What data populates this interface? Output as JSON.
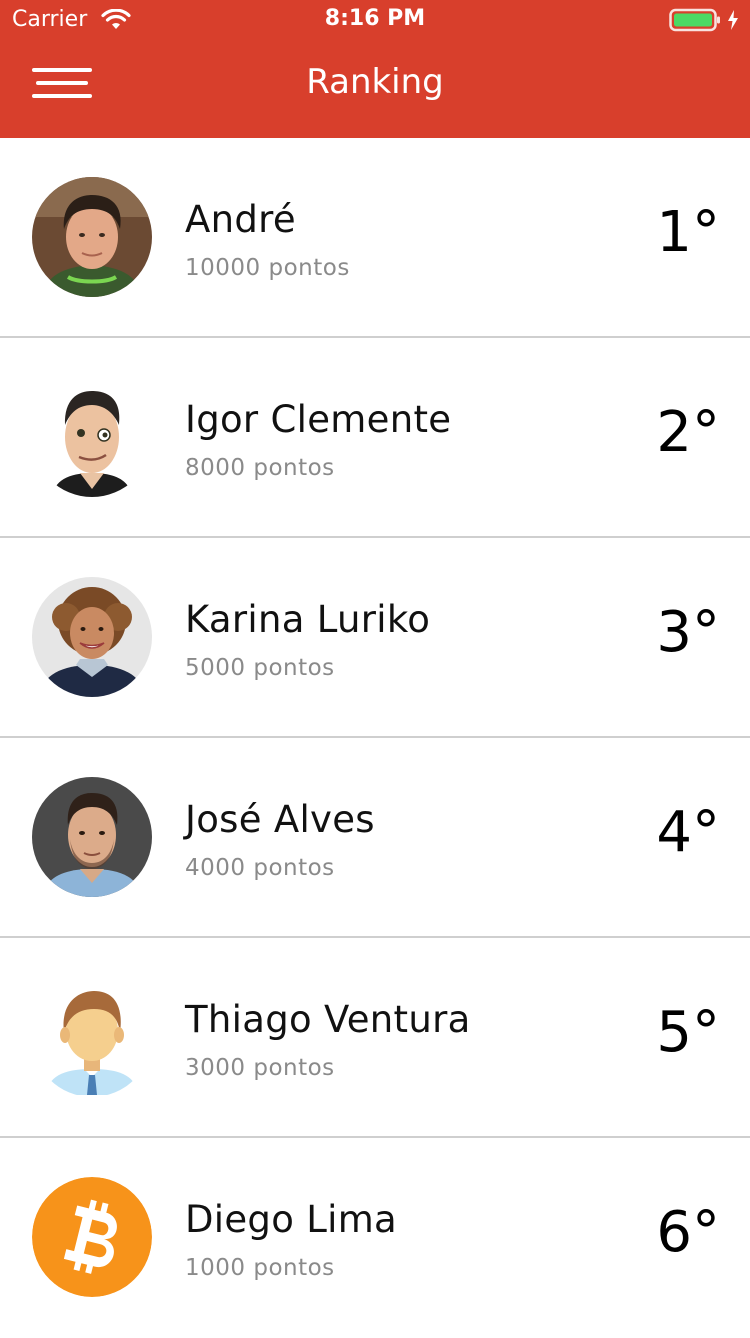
{
  "status_bar": {
    "carrier": "Carrier",
    "time": "8:16 PM",
    "battery_color": "#4cd964"
  },
  "nav": {
    "title": "Ranking",
    "background": "#d83f2c",
    "menu_icon": "hamburger-menu-icon"
  },
  "ranking": [
    {
      "name": "André",
      "points": "10000 pontos",
      "position": "1°",
      "avatar": "photo-young-man"
    },
    {
      "name": "Igor Clemente",
      "points": "8000 pontos",
      "position": "2°",
      "avatar": "photo-man-funny-face"
    },
    {
      "name": "Karina Luriko",
      "points": "5000 pontos",
      "position": "3°",
      "avatar": "photo-woman-curly-hair"
    },
    {
      "name": "José Alves",
      "points": "4000 pontos",
      "position": "4°",
      "avatar": "photo-man-blue-shirt"
    },
    {
      "name": "Thiago Ventura",
      "points": "3000 pontos",
      "position": "5°",
      "avatar": "cartoon-man-icon"
    },
    {
      "name": "Diego Lima",
      "points": "1000 pontos",
      "position": "6°",
      "avatar": "bitcoin-icon"
    }
  ]
}
